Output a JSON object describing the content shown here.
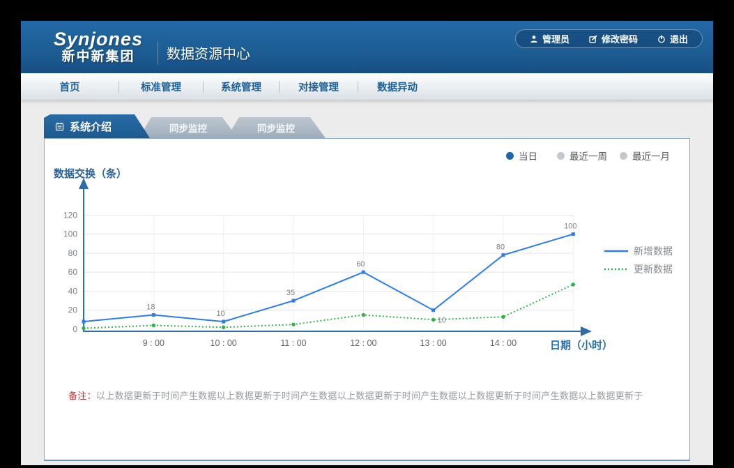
{
  "header": {
    "logo": {
      "en": "Synjones",
      "cn": "新中新集团"
    },
    "title": "数据资源中心",
    "actions": [
      {
        "label": "管理员",
        "icon": "user-icon"
      },
      {
        "label": "修改密码",
        "icon": "edit-icon"
      },
      {
        "label": "退出",
        "icon": "power-icon"
      }
    ]
  },
  "nav": {
    "items": [
      {
        "label": "首页"
      },
      {
        "label": "标准管理"
      },
      {
        "label": "系统管理"
      },
      {
        "label": "对接管理"
      },
      {
        "label": "数据异动"
      }
    ]
  },
  "tabs": [
    {
      "label": "系统介绍",
      "active": true,
      "icon": "notebook-icon"
    },
    {
      "label": "同步监控",
      "active": false
    },
    {
      "label": "同步监控",
      "active": false
    }
  ],
  "filters": {
    "options": [
      {
        "label": "当日",
        "selected": true
      },
      {
        "label": "最近一周",
        "selected": false
      },
      {
        "label": "最近一月",
        "selected": false
      }
    ]
  },
  "chart_data": {
    "type": "line",
    "title": "数据交换（条）",
    "xlabel": "日期（小时）",
    "x_tick_labels": [
      "9 : 00",
      "10 : 00",
      "11 : 00",
      "12 : 00",
      "13 : 00",
      "14 : 00"
    ],
    "yticks": [
      0,
      20,
      40,
      60,
      80,
      100,
      120
    ],
    "ylim": [
      0,
      130
    ],
    "grid": true,
    "legend_position": "right",
    "series": [
      {
        "name": "新增数据",
        "color": "#2e7bf0",
        "style": "solid",
        "values": [
          8,
          15,
          8,
          30,
          60,
          20,
          78,
          100
        ],
        "point_labels": [
          "",
          "18",
          "10",
          "35",
          "60",
          "",
          "80",
          "100"
        ]
      },
      {
        "name": "更新数据",
        "color": "#2fb344",
        "style": "dotted",
        "values": [
          1,
          4,
          2,
          5,
          15,
          10,
          13,
          47
        ],
        "point_labels": [
          "",
          "",
          "",
          "",
          "",
          "10",
          "",
          ""
        ]
      }
    ]
  },
  "note": {
    "prefix": "备注：",
    "text": "以上数据更新于时间产生数据以上数据更新于时间产生数据以上数据更新于时间产生数据以上数据更新于时间产生数据以上数据更新于"
  },
  "colors": {
    "brand_blue": "#1d5e94",
    "chart_blue": "#2e7bf0",
    "chart_green": "#2fb344",
    "note_red": "#c03a3a"
  }
}
